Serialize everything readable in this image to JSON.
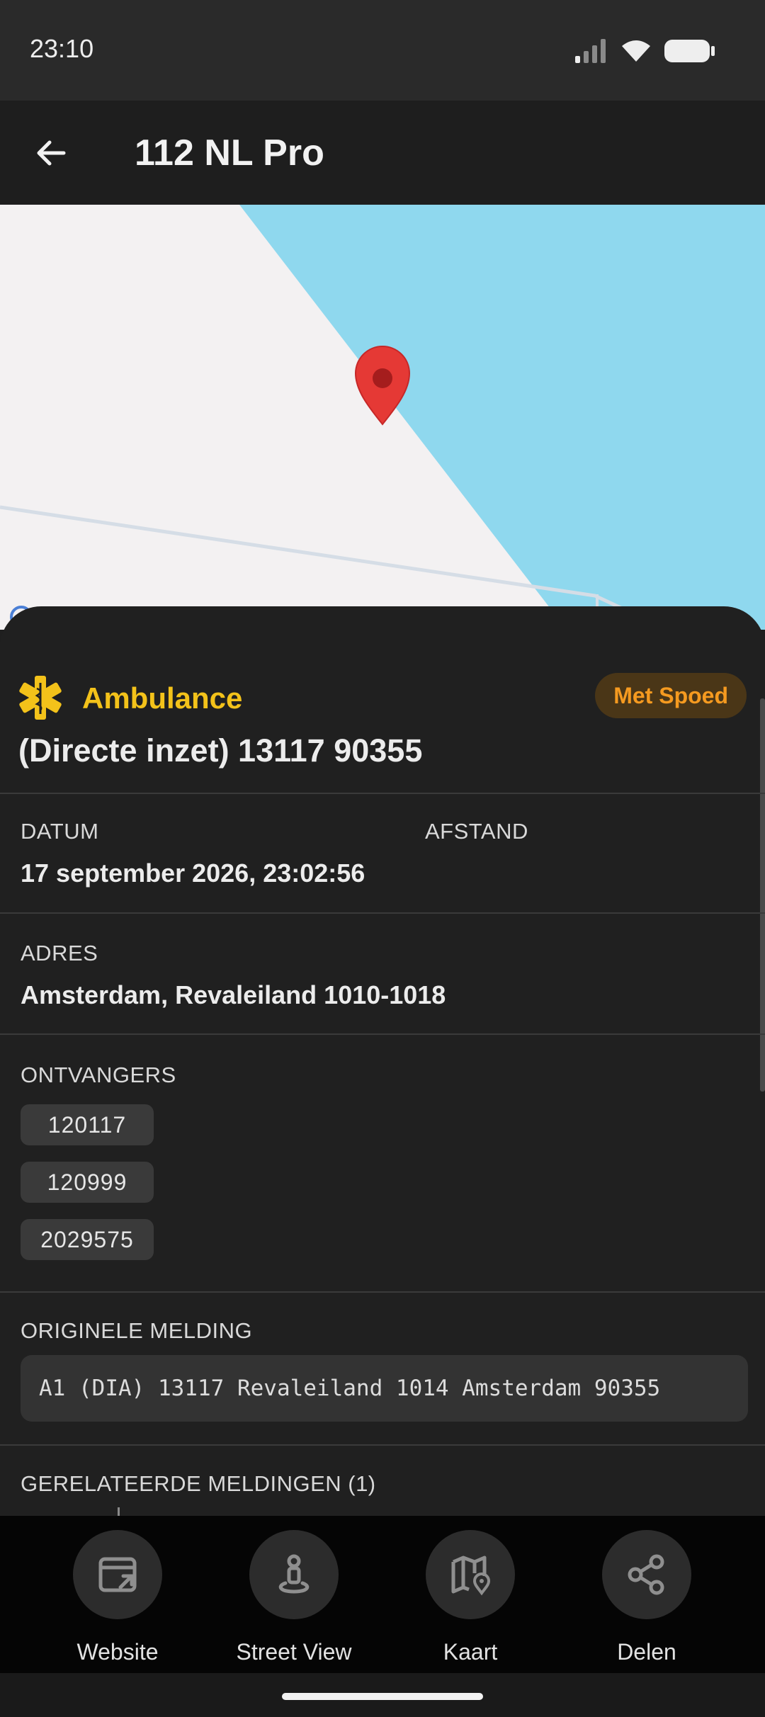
{
  "status_bar": {
    "time": "23:10"
  },
  "app_bar": {
    "title": "112 NL Pro"
  },
  "incident": {
    "type": "Ambulance",
    "type_color": "#f3c21a",
    "priority": "Met Spoed",
    "priority_color": "#f59a20",
    "title": "(Directe inzet) 13117 90355"
  },
  "details": {
    "date_label": "DATUM",
    "date_value": "17 september 2026, 23:02:56",
    "distance_label": "AFSTAND",
    "address_label": "ADRES",
    "address_value": "Amsterdam, Revaleiland 1010-1018",
    "recipients_label": "ONTVANGERS",
    "recipients": [
      "120117",
      "120999",
      "2029575"
    ],
    "original_label": "ORIGINELE MELDING",
    "original_text": "A1 (DIA) 13117 Revaleiland 1014 Amsterdam 90355",
    "related_label": "GERELATEERDE MELDINGEN (1)"
  },
  "actions": [
    {
      "label": "Website",
      "icon": "open-in-browser-icon"
    },
    {
      "label": "Street View",
      "icon": "street-view-icon"
    },
    {
      "label": "Kaart",
      "icon": "map-icon"
    },
    {
      "label": "Delen",
      "icon": "share-icon"
    }
  ],
  "map": {
    "water_color": "#8fd8ee",
    "land_color": "#f3f1f2",
    "marker_color": "#e53935"
  }
}
